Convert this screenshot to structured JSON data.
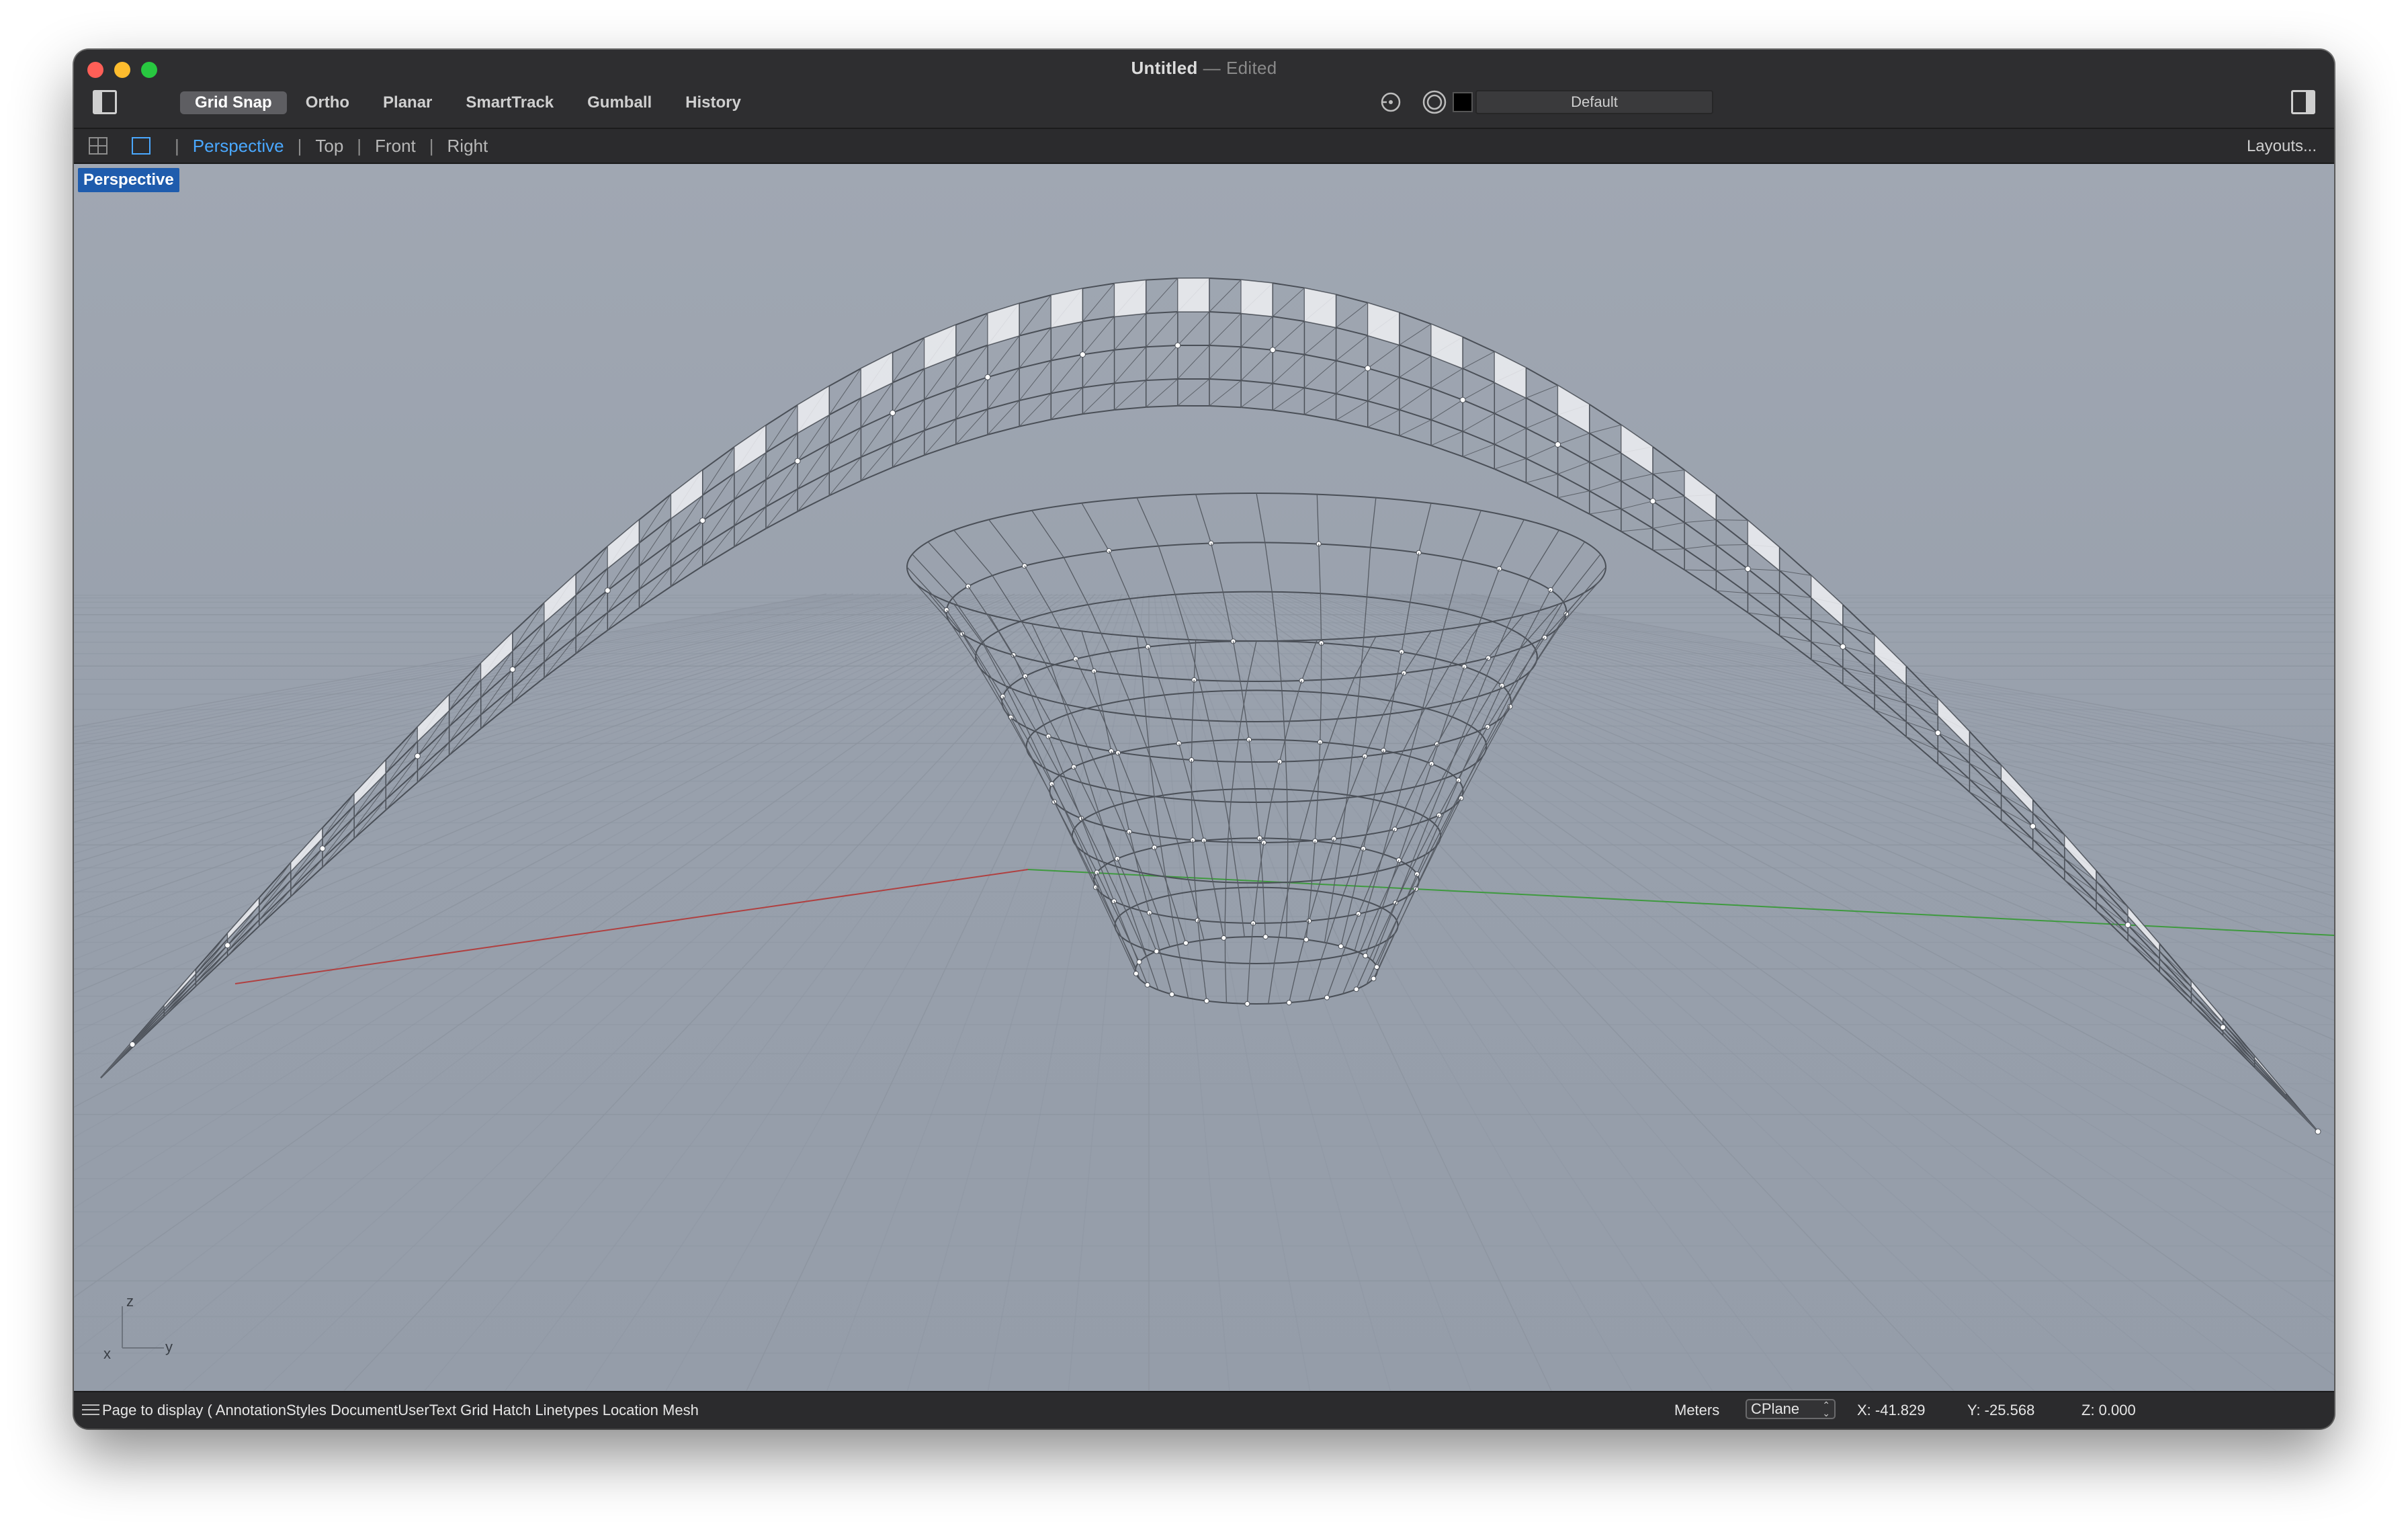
{
  "window": {
    "title": "Untitled",
    "title_separator": "—",
    "title_status": "Edited"
  },
  "toolbar": {
    "modes": [
      {
        "label": "Grid Snap",
        "active": true
      },
      {
        "label": "Ortho",
        "active": false
      },
      {
        "label": "Planar",
        "active": false
      },
      {
        "label": "SmartTrack",
        "active": false
      },
      {
        "label": "Gumball",
        "active": false
      },
      {
        "label": "History",
        "active": false
      }
    ],
    "layer": {
      "name": "Default",
      "color": "#000000"
    }
  },
  "view_tabs": {
    "tabs": [
      "Perspective",
      "Top",
      "Front",
      "Right"
    ],
    "active": "Perspective",
    "layouts_label": "Layouts..."
  },
  "viewport": {
    "label": "Perspective",
    "background": "#9aa2ae",
    "axis_labels": {
      "z": "z",
      "x": "x",
      "y": "y"
    }
  },
  "statusbar": {
    "command_prompt": "Page to display ( AnnotationStyles DocumentUserText Grid Hatch Linetypes Location Mesh",
    "units": "Meters",
    "cplane": "CPlane",
    "x": "X: -41.829",
    "y": "Y: -25.568",
    "z": "Z: 0.000"
  },
  "colors": {
    "accent": "#4aa8ff",
    "viewport_label_bg": "#1f5cad",
    "x_axis": "#b04040",
    "y_axis": "#3f9a3f"
  }
}
